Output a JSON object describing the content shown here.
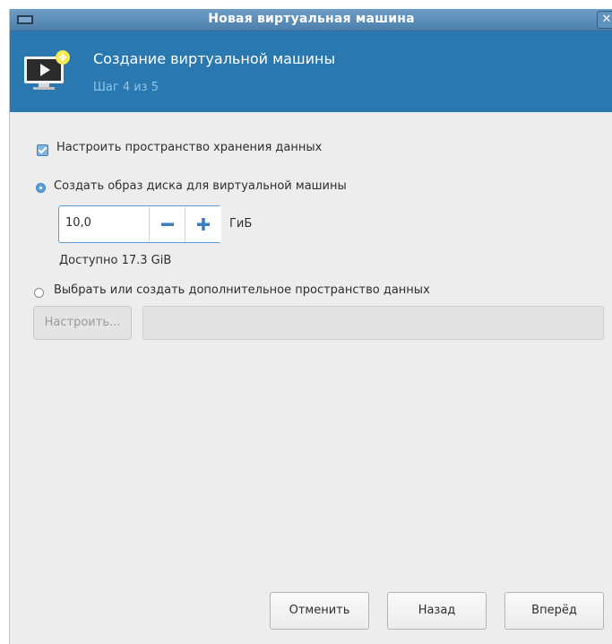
{
  "window": {
    "title": "Новая виртуальная машина",
    "close_glyph": "✕"
  },
  "header": {
    "title": "Создание виртуальной машины",
    "step": "Шаг 4 из 5",
    "icon": "vm-screen-icon"
  },
  "storage": {
    "configure_label": "Настроить пространство хранения данных",
    "configure_checked": true,
    "create_image_label": "Создать образ диска для виртуальной машины",
    "create_image_selected": true,
    "size_value": "10,0",
    "size_unit": "ГиБ",
    "available": "Доступно 17.3 GiB",
    "select_other_label": "Выбрать или создать дополнительное пространство данных",
    "select_other_selected": false,
    "configure_button": "Настроить...",
    "path_value": ""
  },
  "footer": {
    "cancel": "Отменить",
    "back": "Назад",
    "forward": "Вперёд"
  },
  "colors": {
    "header_bg": "#2a78b0",
    "accent": "#3a82c4",
    "step_text": "#8cc6ec"
  }
}
